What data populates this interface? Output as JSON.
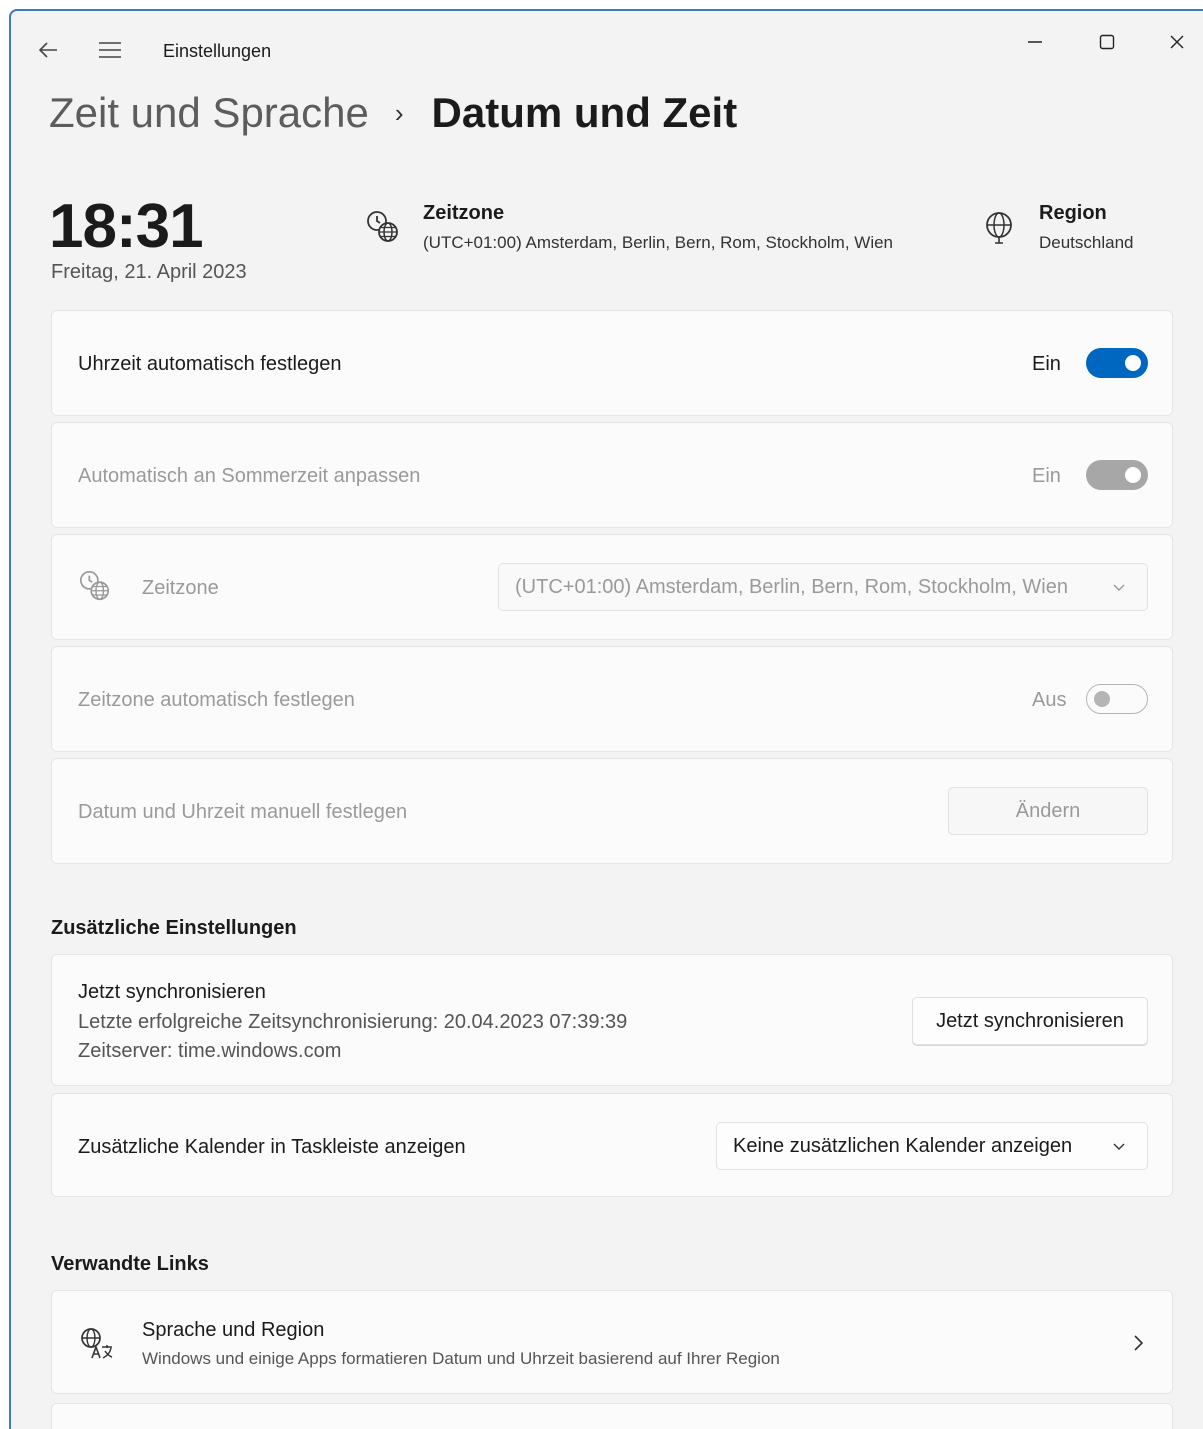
{
  "app": {
    "title": "Einstellungen"
  },
  "breadcrumb": {
    "parent": "Zeit und Sprache",
    "separator": "›",
    "current": "Datum und Zeit"
  },
  "header": {
    "time": "18:31",
    "date": "Freitag, 21. April 2023",
    "timezone_title": "Zeitzone",
    "timezone_value": "(UTC+01:00) Amsterdam, Berlin, Bern, Rom, Stockholm, Wien",
    "region_title": "Region",
    "region_value": "Deutschland"
  },
  "settings": {
    "auto_time": {
      "label": "Uhrzeit automatisch festlegen",
      "state": "Ein"
    },
    "auto_dst": {
      "label": "Automatisch an Sommerzeit anpassen",
      "state": "Ein"
    },
    "timezone": {
      "label": "Zeitzone",
      "value": "(UTC+01:00) Amsterdam, Berlin, Bern, Rom, Stockholm, Wien"
    },
    "auto_timezone": {
      "label": "Zeitzone automatisch festlegen",
      "state": "Aus"
    },
    "manual": {
      "label": "Datum und Uhrzeit manuell festlegen",
      "button": "Ändern"
    }
  },
  "additional": {
    "title": "Zusätzliche Einstellungen",
    "sync": {
      "title": "Jetzt synchronisieren",
      "last_sync": "Letzte erfolgreiche Zeitsynchronisierung: 20.04.2023 07:39:39",
      "server": "Zeitserver: time.windows.com",
      "button": "Jetzt synchronisieren"
    },
    "calendar": {
      "label": "Zusätzliche Kalender in Taskleiste anzeigen",
      "value": "Keine zusätzlichen Kalender anzeigen"
    }
  },
  "related": {
    "title": "Verwandte Links",
    "items": [
      {
        "title": "Sprache und Region",
        "desc": "Windows und einige Apps formatieren Datum und Uhrzeit basierend auf Ihrer Region",
        "icon": "language-region-icon"
      }
    ]
  },
  "colors": {
    "accent": "#0067c0",
    "window_border": "#3b78c9",
    "background": "#f3f3f3",
    "card": "#fbfbfb"
  }
}
